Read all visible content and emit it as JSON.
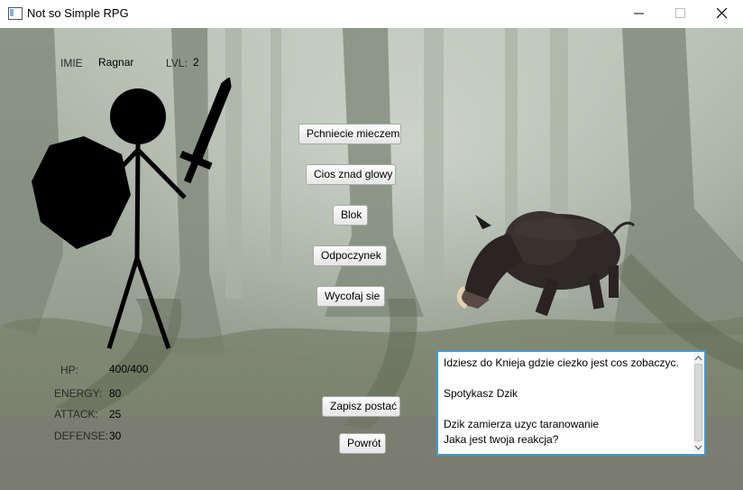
{
  "window": {
    "title": "Not so Simple RPG"
  },
  "player": {
    "name_label": "IMIE",
    "name": "Ragnar",
    "level_label": "LVL:",
    "level": "2"
  },
  "stats": {
    "hp_label": "HP:",
    "hp": "400/400",
    "energy_label": "ENERGY:",
    "energy": "80",
    "attack_label": "ATTACK:",
    "attack": "25",
    "defense_label": "DEFENSE:",
    "defense": "30"
  },
  "actions": {
    "thrust": "Pchniecie mieczem",
    "overhead": "Cios znad glowy",
    "block": "Blok",
    "rest": "Odpoczynek",
    "retreat": "Wycofaj sie"
  },
  "footer": {
    "save": "Zapisz postać",
    "back": "Powrót"
  },
  "log": {
    "text": "Idziesz do Knieja gdzie ciezko jest cos zobaczyc.\n\nSpotykasz Dzik\n\nDzik zamierza uzyc taranowanie\nJaka jest twoja reakcja?"
  },
  "colors": {
    "focus": "#3c9bd6",
    "forest_bg": "#8e9a8c"
  }
}
